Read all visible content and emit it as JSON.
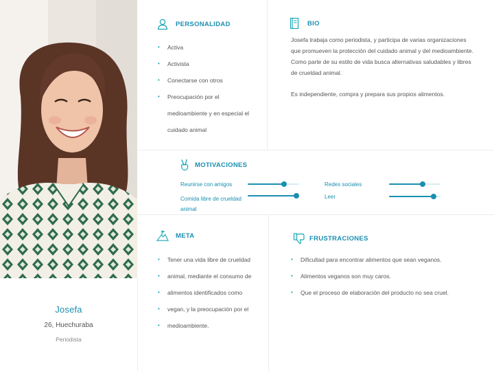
{
  "profile": {
    "name": "Josefa",
    "location": "26, Huechuraba",
    "occupation": "Periodista"
  },
  "personality": {
    "title": "PERSONALIDAD",
    "icon": "user-icon",
    "items": [
      "Activa",
      "Activista",
      "Conectarse con otros",
      "Preocupación por el",
      "medioambiente y en especial el",
      "cuidado animal"
    ]
  },
  "bio": {
    "title": "BIO",
    "icon": "notebook-icon",
    "paragraph1": "Josefa trabaja como periodista, y participa de varias organizaciones que promueven la protección del cuidado animal y del medioambiente.",
    "paragraph2": "Como parte de su estilo de vida busca alternativas saludables y libres de crueldad animal.",
    "paragraph3": "Es independiente, compra y prepara sus propios alimentos."
  },
  "motivations": {
    "title": "MOTIVACIONES",
    "icon": "peace-hand-icon",
    "items": [
      {
        "label": "Reunirse con amigos",
        "level": 0.7
      },
      {
        "label": "Redes sociales",
        "level": 0.65
      },
      {
        "label": "Comida libre de crueldad animal",
        "label_line1": "Comida libre de crueldad",
        "label_line2": "animal",
        "level": 0.95
      },
      {
        "label": "Leer",
        "level": 0.87
      }
    ]
  },
  "goal": {
    "title": "META",
    "icon": "mountain-flag-icon",
    "items": [
      "Tener una vida libre de crueldad",
      "animal, mediante el consumo de",
      "alimentos identificados como",
      "vegan, y la preocupación por el",
      "medioambiente."
    ]
  },
  "frustrations": {
    "title": "FRUSTRACIONES",
    "icon": "thumbs-down-icon",
    "items": [
      "Dificultad para encontrar alimentos que sean veganos.",
      "Alimentos veganos son muy caros.",
      "Que el proceso de elaboración del producto no sea cruel."
    ]
  },
  "colors": {
    "accent": "#1a8fb0",
    "bullet": "#1aa7b5",
    "track": "#d9eef3"
  }
}
